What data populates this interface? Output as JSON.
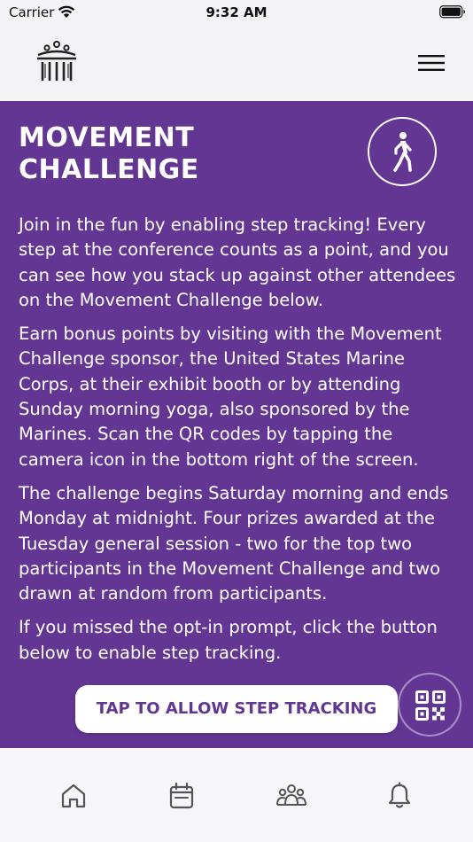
{
  "status_bar": {
    "carrier": "Carrier",
    "time": "9:32 AM"
  },
  "header": {
    "logo_icon": "capitol-building-icon",
    "menu_icon": "hamburger-menu-icon"
  },
  "challenge": {
    "title": "MOVEMENT CHALLENGE",
    "icon": "walking-person-icon",
    "paragraphs": [
      "Join in the fun by enabling step tracking! Every step at the conference counts as a point, and you can see how you stack up against other attendees on the Movement Challenge below.",
      "Earn bonus points by visiting with the Movement Challenge sponsor, the United States Marine Corps, at their exhibit booth or by attending Sunday morning yoga, also sponsored by the Marines. Scan the QR codes by tapping the camera icon in the bottom right of the screen.",
      "The challenge begins Saturday morning and ends Monday at midnight. Four prizes awarded at the Tuesday general session - two for the top two participants in the Movement Challenge and two drawn at random from participants.",
      "If you missed the opt-in prompt, click the button below to enable step tracking."
    ],
    "cta_label": "TAP TO ALLOW STEP TRACKING",
    "qr_icon": "qr-code-icon"
  },
  "tab_bar": {
    "tabs": [
      {
        "icon": "home-icon"
      },
      {
        "icon": "calendar-icon"
      },
      {
        "icon": "people-icon"
      },
      {
        "icon": "bell-icon"
      }
    ]
  },
  "colors": {
    "brand_purple": "#633694",
    "background": "#f3f3f5",
    "icon_gray": "#555555"
  }
}
